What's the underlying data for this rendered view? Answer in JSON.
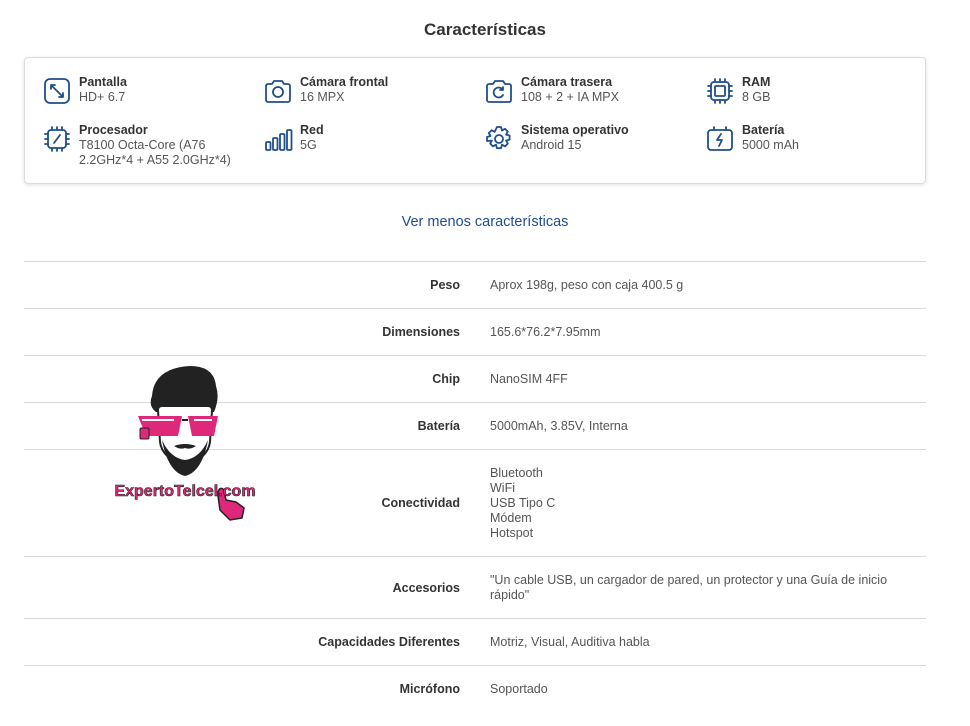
{
  "section": {
    "title": "Características"
  },
  "features": [
    {
      "label": "Pantalla",
      "value": "HD+ 6.7",
      "icon": "screen-resize-icon"
    },
    {
      "label": "Cámara frontal",
      "value": "16 MPX",
      "icon": "camera-icon"
    },
    {
      "label": "Cámara trasera",
      "value": "108 + 2 + IA MPX",
      "icon": "camera-rotate-icon"
    },
    {
      "label": "RAM",
      "value": "8 GB",
      "icon": "ram-chip-icon"
    },
    {
      "label": "Procesador",
      "value": "T8100 Octa-Core (A76 2.2GHz*4 + A55 2.0GHz*4)",
      "icon": "processor-icon"
    },
    {
      "label": "Red",
      "value": "5G",
      "icon": "signal-bars-icon"
    },
    {
      "label": "Sistema operativo",
      "value": "Android 15",
      "icon": "gear-icon"
    },
    {
      "label": "Batería",
      "value": "5000 mAh",
      "icon": "battery-icon"
    }
  ],
  "toggle_label": "Ver menos características",
  "specs": [
    {
      "key": "Peso",
      "values": [
        "Aprox 198g, peso con caja 400.5 g"
      ]
    },
    {
      "key": "Dimensiones",
      "values": [
        "165.6*76.2*7.95mm"
      ]
    },
    {
      "key": "Chip",
      "values": [
        "NanoSIM 4FF"
      ]
    },
    {
      "key": "Batería",
      "values": [
        "5000mAh, 3.85V, Interna"
      ]
    },
    {
      "key": "Conectividad",
      "values": [
        "Bluetooth",
        "WiFi",
        "USB Tipo C",
        "Módem",
        "Hotspot"
      ]
    },
    {
      "key": "Accesorios",
      "values": [
        "\"Un cable USB, un cargador de pared, un protector y una Guía de inicio rápido\""
      ]
    },
    {
      "key": "Capacidades Diferentes",
      "values": [
        "Motriz, Visual, Auditiva habla"
      ]
    },
    {
      "key": "Micrófono",
      "values": [
        "Soportado"
      ]
    }
  ],
  "watermark": {
    "text": "ExpertoTelcel.com"
  },
  "colors": {
    "icon": "#1f4e8c",
    "link": "#1f4e8c",
    "logo_pink": "#e0287a"
  }
}
